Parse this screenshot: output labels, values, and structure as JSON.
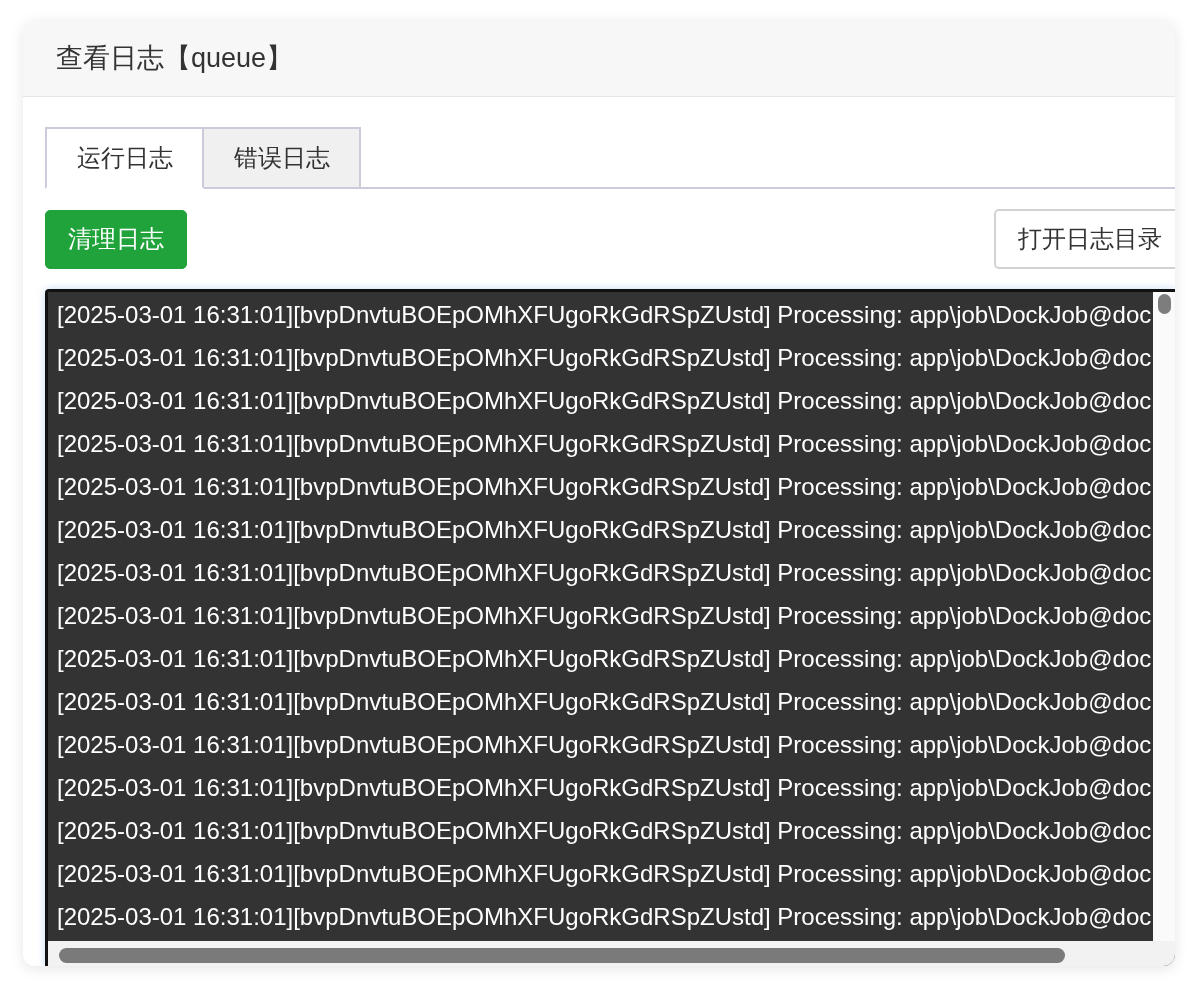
{
  "header": {
    "title": "查看日志【queue】"
  },
  "tabs": [
    {
      "label": "运行日志",
      "selected": true
    },
    {
      "label": "错误日志",
      "selected": false
    }
  ],
  "toolbar": {
    "buttons": [
      {
        "label": "清理日志",
        "kind": "primary"
      },
      {
        "label": "打开日志目录",
        "kind": "default"
      }
    ]
  },
  "log": {
    "lines": [
      "[2025-03-01 16:31:01][bvpDnvtuBOEpOMhXFUgoRkGdRSpZUstd] Processing: app\\job\\DockJob@doc",
      "[2025-03-01 16:31:01][bvpDnvtuBOEpOMhXFUgoRkGdRSpZUstd] Processing: app\\job\\DockJob@doc",
      "[2025-03-01 16:31:01][bvpDnvtuBOEpOMhXFUgoRkGdRSpZUstd] Processing: app\\job\\DockJob@doc",
      "[2025-03-01 16:31:01][bvpDnvtuBOEpOMhXFUgoRkGdRSpZUstd] Processing: app\\job\\DockJob@doc",
      "[2025-03-01 16:31:01][bvpDnvtuBOEpOMhXFUgoRkGdRSpZUstd] Processing: app\\job\\DockJob@doc",
      "[2025-03-01 16:31:01][bvpDnvtuBOEpOMhXFUgoRkGdRSpZUstd] Processing: app\\job\\DockJob@doc",
      "[2025-03-01 16:31:01][bvpDnvtuBOEpOMhXFUgoRkGdRSpZUstd] Processing: app\\job\\DockJob@doc",
      "[2025-03-01 16:31:01][bvpDnvtuBOEpOMhXFUgoRkGdRSpZUstd] Processing: app\\job\\DockJob@doc",
      "[2025-03-01 16:31:01][bvpDnvtuBOEpOMhXFUgoRkGdRSpZUstd] Processing: app\\job\\DockJob@doc",
      "[2025-03-01 16:31:01][bvpDnvtuBOEpOMhXFUgoRkGdRSpZUstd] Processing: app\\job\\DockJob@doc",
      "[2025-03-01 16:31:01][bvpDnvtuBOEpOMhXFUgoRkGdRSpZUstd] Processing: app\\job\\DockJob@doc",
      "[2025-03-01 16:31:01][bvpDnvtuBOEpOMhXFUgoRkGdRSpZUstd] Processing: app\\job\\DockJob@doc",
      "[2025-03-01 16:31:01][bvpDnvtuBOEpOMhXFUgoRkGdRSpZUstd] Processing: app\\job\\DockJob@doc",
      "[2025-03-01 16:31:01][bvpDnvtuBOEpOMhXFUgoRkGdRSpZUstd] Processing: app\\job\\DockJob@doc",
      "[2025-03-01 16:31:01][bvpDnvtuBOEpOMhXFUgoRkGdRSpZUstd] Processing: app\\job\\DockJob@doc"
    ]
  }
}
